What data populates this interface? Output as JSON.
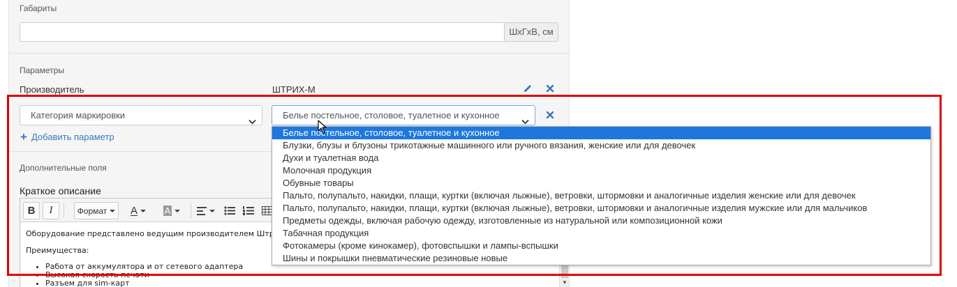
{
  "dimensions": {
    "label": "Габариты",
    "value": "",
    "unit": "ШхГхВ, см"
  },
  "parameters": {
    "label": "Параметры",
    "manufacturer_name": "Производитель",
    "manufacturer_value": "ШТРИХ-М",
    "category_select": "Категория маркировки",
    "value_select": "Белье постельное, столовое, туалетное и кухонное",
    "add_parameter": "Добавить параметр"
  },
  "dropdown": {
    "selected_index": 0,
    "options": [
      "Белье постельное, столовое, туалетное и кухонное",
      "Блузки, блузы и блузоны трикотажные машинного или ручного вязания, женские или для девочек",
      "Духи и туалетная вода",
      "Молочная продукция",
      "Обувные товары",
      "Пальто, полупальто, накидки, плащи, куртки (включая лыжные), ветровки, штормовки и аналогичные изделия женские или для девочек",
      "Пальто, полупальто, накидки, плащи, куртки (включая лыжные), ветровки, штормовки и аналогичные изделия мужские или для мальчиков",
      "Предметы одежды, включая рабочую одежду, изготовленные из натуральной или композиционной кожи",
      "Табачная продукция",
      "Фотокамеры (кроме кинокамер), фотовспышки и лампы-вспышки",
      "Шины и покрышки пневматические резиновые новые"
    ]
  },
  "extra_fields": {
    "label": "Дополнительные поля",
    "short_description_title": "Краткое описание"
  },
  "editor": {
    "toolbar": {
      "bold": "B",
      "italic": "I",
      "format": "Формат",
      "font_color": "A",
      "bg_color": "A"
    },
    "content": {
      "intro": "Оборудование представлено ведущим производителем Штрих",
      "advantages": "Преимущества:",
      "items": [
        "Работа от аккумулятора и от сетевого адаптера",
        "Высокая скорость печати",
        "Разъем для sim-карт"
      ]
    }
  },
  "colors": {
    "accent_blue": "#1e77de",
    "link_blue": "#3a78b8",
    "highlight_red": "#e00000"
  }
}
